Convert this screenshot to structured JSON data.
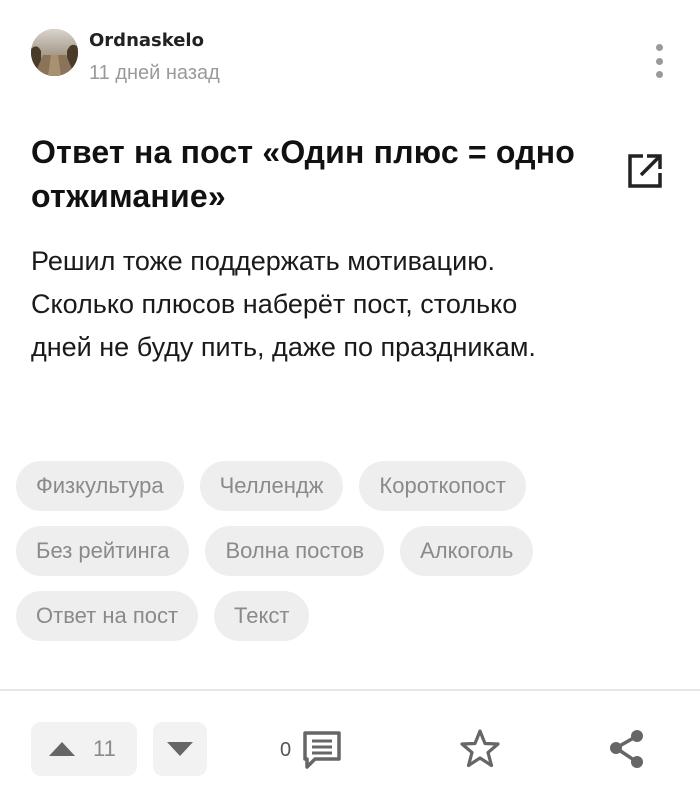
{
  "header": {
    "author": "Ordnaskelo",
    "time": "11 дней назад"
  },
  "post": {
    "title": "Ответ на пост «Один плюс = одно отжимание»",
    "body_lines": [
      "Решил тоже поддержать мотивацию.",
      "Сколько плюсов наберёт пост, столько",
      "дней не буду пить, даже по праздникам."
    ]
  },
  "tags": [
    [
      "Физкультура",
      "Челлендж",
      "Короткопост"
    ],
    [
      "Без рейтинга",
      "Волна постов",
      "Алкоголь"
    ],
    [
      "Ответ на пост",
      "Текст"
    ]
  ],
  "footer": {
    "rating": "11",
    "comments": "0"
  },
  "icons": {
    "menu": "kebab-menu-icon",
    "open": "open-external-icon",
    "upvote": "triangle-up-icon",
    "downvote": "triangle-down-icon",
    "comments": "comment-icon",
    "save": "star-outline-icon",
    "share": "share-icon"
  },
  "colors": {
    "muted": "#9a9a9a",
    "chip_bg": "#eeeeee",
    "icon": "#666666"
  }
}
